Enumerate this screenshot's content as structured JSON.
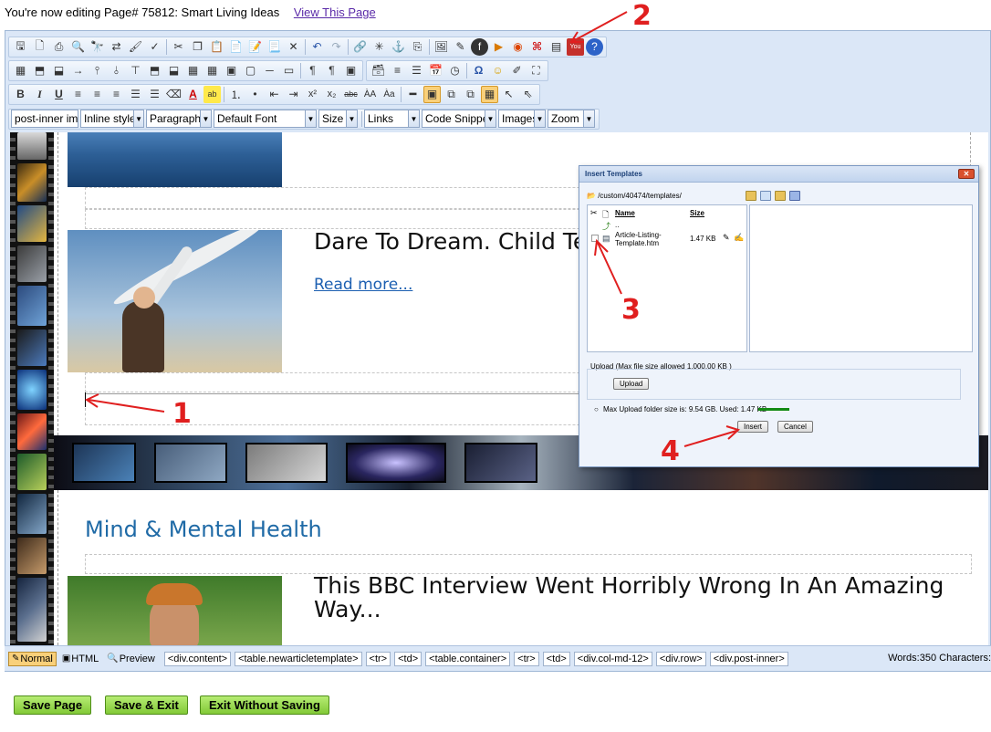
{
  "page": {
    "editing_text": "You're now editing Page# 75812: Smart Living Ideas",
    "view_link": "View This Page"
  },
  "toolbar": {
    "row1_icons": [
      "save-icon",
      "new-page-icon",
      "print-icon",
      "print-preview-icon",
      "find-icon",
      "replace-icon",
      "format-painter-icon",
      "spellcheck-icon",
      "cut-icon",
      "copy-icon",
      "paste-icon",
      "paste-text-icon",
      "paste-word-icon",
      "paste-html-icon",
      "delete-icon",
      "undo-icon",
      "redo-icon",
      "link-icon",
      "unlink-icon",
      "anchor-icon",
      "insert-box-icon",
      "image-icon",
      "flash-icon",
      "media-icon",
      "youtube-play-icon",
      "pdf-icon",
      "template-icon",
      "youtube-icon",
      "help-icon"
    ],
    "row3_buttons": {
      "bold": "B",
      "italic": "I",
      "underline": "U"
    },
    "dropdowns": {
      "css_class": "post-inner img",
      "inline_style": "Inline style",
      "paragraph": "Paragraph",
      "font": "Default Font",
      "size": "Size",
      "links": "Links",
      "code_snippet": "Code Snippet",
      "images": "Images",
      "zoom": "Zoom"
    }
  },
  "content": {
    "post1_title": "Dare To Dream. Child Te",
    "read_more": "Read more...",
    "section_heading": "Mind & Mental Health",
    "post2_title": "This BBC Interview Went Horribly Wrong In An Amazing Way..."
  },
  "statusbar": {
    "modes": [
      "Normal",
      "HTML",
      "Preview"
    ],
    "tags": [
      "<div.content>",
      "<table.newarticletemplate>",
      "<tr>",
      "<td>",
      "<table.container>",
      "<tr>",
      "<td>",
      "<div.col-md-12>",
      "<div.row>",
      "<div.post-inner>"
    ],
    "words_text": "Words:350 Characters:"
  },
  "footer": {
    "save_page": "Save Page",
    "save_exit": "Save & Exit",
    "exit_without_saving": "Exit Without Saving"
  },
  "dialog": {
    "title": "Insert Templates",
    "path": "/custom/40474/templates/",
    "col_name": "Name",
    "col_size": "Size",
    "parent_dir": "..",
    "file_name_line1": "Article-Listing-",
    "file_name_line2": "Template.htm",
    "file_size": "1.47 KB",
    "upload_label": "Upload (Max file size allowed 1,000.00 KB )",
    "upload_button": "Upload",
    "folder_info": "Max Upload folder size is: 9.54 GB.  Used: 1.47 KB",
    "folder_usage_fraction": 0.0002,
    "insert_button": "Insert",
    "cancel_button": "Cancel"
  },
  "annotations": {
    "a1": "1",
    "a2": "2",
    "a3": "3",
    "a4": "4"
  },
  "colors": {
    "annotation": "#e01f1f",
    "toolbar_bg": "#dbe7f7",
    "section_heading": "#1f6aa6",
    "save_button": "#9ad651"
  }
}
